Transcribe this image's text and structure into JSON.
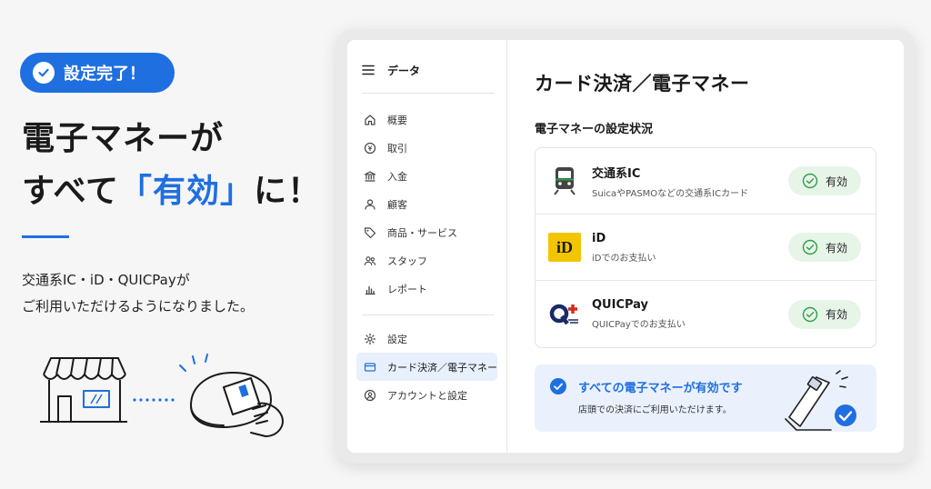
{
  "hero": {
    "badge": "設定完了！",
    "headline_line1": "電子マネーが",
    "headline_line2_pre": "すべて",
    "headline_line2_accent": "「有効」",
    "headline_line2_post": "に！",
    "sub_line1": "交通系IC・iD・QUICPayが",
    "sub_line2": "ご利用いただけるようになりました。"
  },
  "sidebar": {
    "title": "データ",
    "items": [
      {
        "label": "概要",
        "icon": "home-icon"
      },
      {
        "label": "取引",
        "icon": "yen-icon"
      },
      {
        "label": "入金",
        "icon": "bank-icon"
      },
      {
        "label": "顧客",
        "icon": "person-icon"
      },
      {
        "label": "商品・サービス",
        "icon": "tag-icon"
      },
      {
        "label": "スタッフ",
        "icon": "people-icon"
      },
      {
        "label": "レポート",
        "icon": "chart-icon"
      }
    ],
    "items2": [
      {
        "label": "設定",
        "icon": "gear-icon"
      },
      {
        "label": "カード決済／電子マネー",
        "icon": "card-icon"
      },
      {
        "label": "アカウントと設定",
        "icon": "account-icon"
      }
    ]
  },
  "main": {
    "title": "カード決済／電子マネー",
    "section": "電子マネーの設定状況",
    "methods": [
      {
        "name": "交通系IC",
        "desc": "SuicaやPASMOなどの交通系ICカード",
        "status": "有効"
      },
      {
        "name": "iD",
        "desc": "iDでのお支払い",
        "status": "有効",
        "logo_text": "iD"
      },
      {
        "name": "QUICPay",
        "desc": "QUICPayでのお支払い",
        "status": "有効"
      }
    ],
    "banner": {
      "title": "すべての電子マネーが有効です",
      "sub": "店頭での決済にご利用いただけます。"
    }
  },
  "colors": {
    "accent": "#1f6fe0",
    "status_bg": "#e7f5e9",
    "status_green": "#2e9e48",
    "id_yellow": "#f2c500"
  }
}
